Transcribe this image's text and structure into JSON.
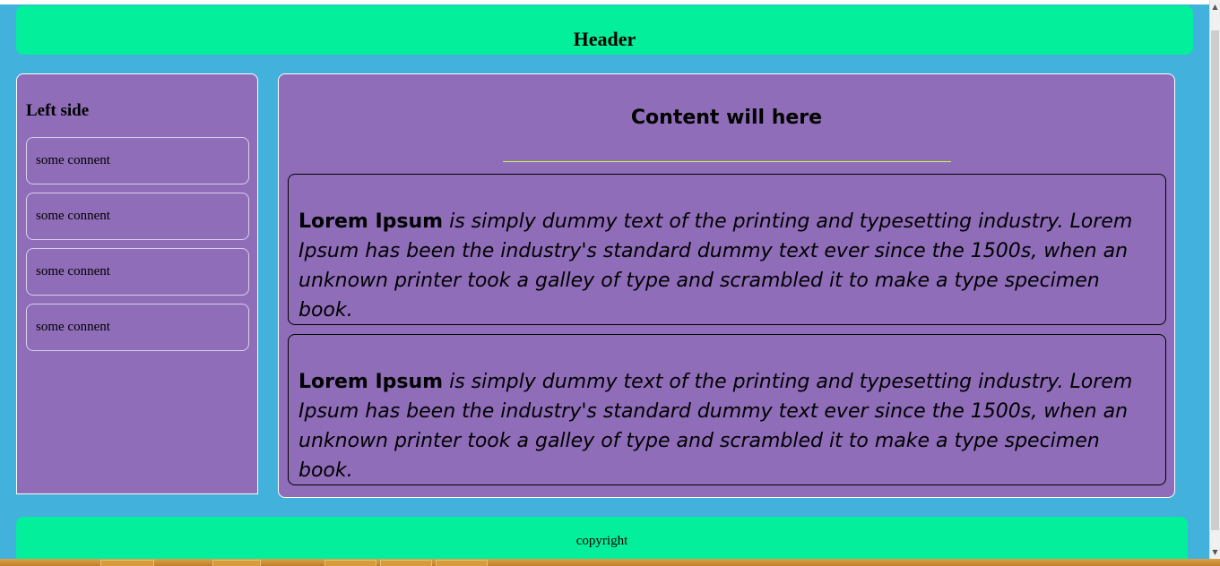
{
  "header": {
    "title": "Header"
  },
  "left": {
    "title": "Left side",
    "items": [
      "some connent",
      "some connent",
      "some connent",
      "some connent"
    ]
  },
  "content": {
    "title": "Content will here",
    "cards": [
      {
        "bold": "Lorem Ipsum",
        "text": " is simply dummy text of the printing and typesetting industry. Lorem Ipsum has been the industry's standard dummy text ever since the 1500s, when an unknown printer took a galley of type and scrambled it to make a type specimen book."
      },
      {
        "bold": "Lorem Ipsum",
        "text": " is simply dummy text of the printing and typesetting industry. Lorem Ipsum has been the industry's standard dummy text ever since the 1500s, when an unknown printer took a galley of type and scrambled it to make a type specimen book."
      }
    ]
  },
  "footer": {
    "text": "copyright"
  },
  "colors": {
    "background": "#42b1dc",
    "header": "#04ef9b",
    "panel": "#8f6db8",
    "divider": "#c8ff3a"
  },
  "icons": {
    "scroll_up": "scroll-up-icon",
    "scroll_down": "scroll-down-icon"
  }
}
